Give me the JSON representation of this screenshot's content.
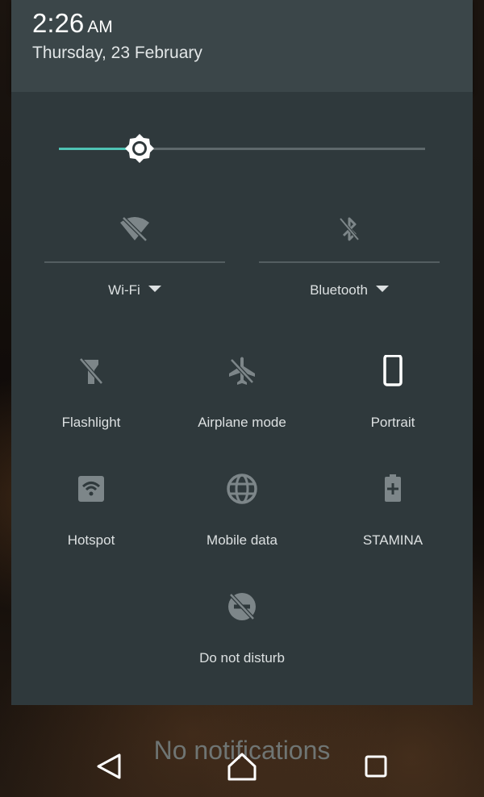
{
  "status": {
    "time": "2:26",
    "ampm": "AM",
    "date": "Thursday, 23 February"
  },
  "brightness": {
    "level": 0.22
  },
  "big_tiles": [
    {
      "label": "Wi-Fi",
      "icon": "wifi-off-icon"
    },
    {
      "label": "Bluetooth",
      "icon": "bluetooth-off-icon"
    }
  ],
  "tiles": [
    {
      "label": "Flashlight",
      "icon": "flashlight-off-icon"
    },
    {
      "label": "Airplane mode",
      "icon": "airplane-icon"
    },
    {
      "label": "Portrait",
      "icon": "phone-portrait-icon"
    },
    {
      "label": "Hotspot",
      "icon": "hotspot-icon"
    },
    {
      "label": "Mobile data",
      "icon": "globe-icon"
    },
    {
      "label": "STAMINA",
      "icon": "battery-plus-icon"
    },
    {
      "label": "Do not disturb",
      "icon": "do-not-disturb-icon"
    }
  ],
  "notifications": {
    "empty_text": "No notifications"
  },
  "colors": {
    "accent": "#4fc3b4",
    "panel": "#2f393c",
    "header": "#3b4649"
  }
}
